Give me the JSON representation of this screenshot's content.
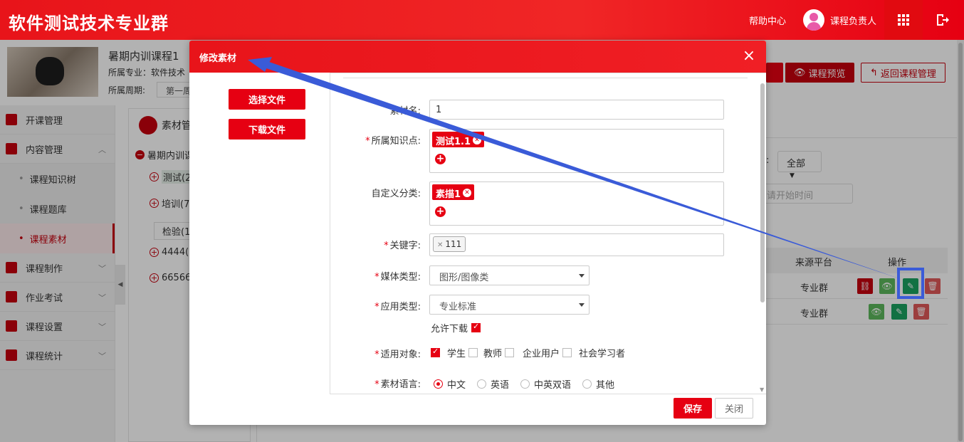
{
  "topbar": {
    "title": "软件测试技术专业群",
    "help": "帮助中心",
    "user": "课程负责人",
    "apps_icon": "grid-icon",
    "logout_icon": "logout-icon"
  },
  "course": {
    "name": "暑期内训课程1",
    "major_label": "所属专业：软件技术",
    "period_label": "所属周期:",
    "period_value": "第一周",
    "preview_btn": "课程预览",
    "back_btn": "返回课程管理"
  },
  "sidebar": {
    "items": [
      {
        "label": "开课管理"
      },
      {
        "label": "内容管理"
      },
      {
        "label": "课程制作"
      },
      {
        "label": "作业考试"
      },
      {
        "label": "课程设置"
      },
      {
        "label": "课程统计"
      }
    ],
    "subitems": [
      "课程知识树",
      "课程题库",
      "课程素材"
    ]
  },
  "tree": {
    "title": "素材管",
    "root": "暑期内训课",
    "nodes": [
      "测试(2",
      "培训(7",
      "检验(1",
      "4444(",
      "66566"
    ]
  },
  "main": {
    "filter_colon": ":",
    "filter_value": "全部",
    "date_placeholder": "请开始时间",
    "col_source": "来源平台",
    "col_ops": "操作",
    "rows": [
      {
        "source": "专业群"
      },
      {
        "source": "专业群"
      }
    ]
  },
  "modal": {
    "title": "修改素材",
    "close": "×",
    "select_file": "选择文件",
    "download_file": "下载文件",
    "fields": {
      "name_label": "素材名:",
      "name_value": "1",
      "knowledge_label": "所属知识点:",
      "knowledge_tag": "测试1.1",
      "category_label": "自定义分类:",
      "category_tag": "素描1",
      "keyword_label": "关键字:",
      "keyword_value": "111",
      "media_label": "媒体类型:",
      "media_value": "图形/图像类",
      "app_label": "应用类型:",
      "app_value": "专业标准",
      "allow_download": "允许下载",
      "audience_label": "适用对象:",
      "audience_options": [
        "学生",
        "教师",
        "企业用户",
        "社会学习者"
      ],
      "language_label": "素材语言:",
      "language_options": [
        "中文",
        "英语",
        "中英双语",
        "其他"
      ]
    },
    "save": "保存",
    "cancel": "关闭"
  },
  "colors": {
    "brand": "#e60012",
    "annotation": "#3a5bd8"
  }
}
